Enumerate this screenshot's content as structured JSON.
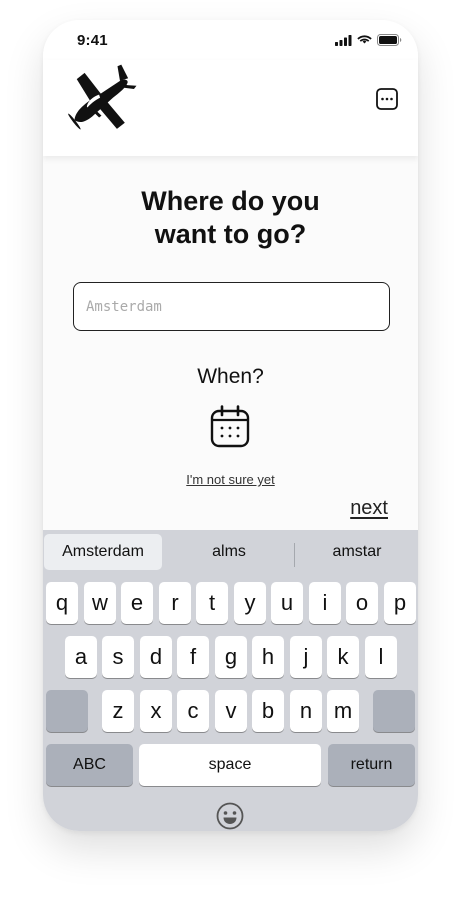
{
  "status_bar": {
    "time": "9:41"
  },
  "header": {
    "logo_icon": "airplane-icon",
    "menu_icon": "chat-bubble-dots-icon"
  },
  "main": {
    "title_line1": "Where do you",
    "title_line2": "want to go?",
    "destination_placeholder": "Amsterdam",
    "when_label": "When?",
    "calendar_icon": "calendar-icon",
    "not_sure_label": "I'm not sure yet",
    "next_label": "next"
  },
  "keyboard": {
    "suggestions": [
      "Amsterdam",
      "alms",
      "amstar"
    ],
    "row1": [
      "q",
      "w",
      "e",
      "r",
      "t",
      "y",
      "u",
      "i",
      "o",
      "p"
    ],
    "row2": [
      "a",
      "s",
      "d",
      "f",
      "g",
      "h",
      "j",
      "k",
      "l"
    ],
    "row3": [
      "z",
      "x",
      "c",
      "v",
      "b",
      "n",
      "m"
    ],
    "abc_label": "ABC",
    "space_label": "space",
    "return_label": "return",
    "emoji_icon": "smiley-face-icon"
  }
}
